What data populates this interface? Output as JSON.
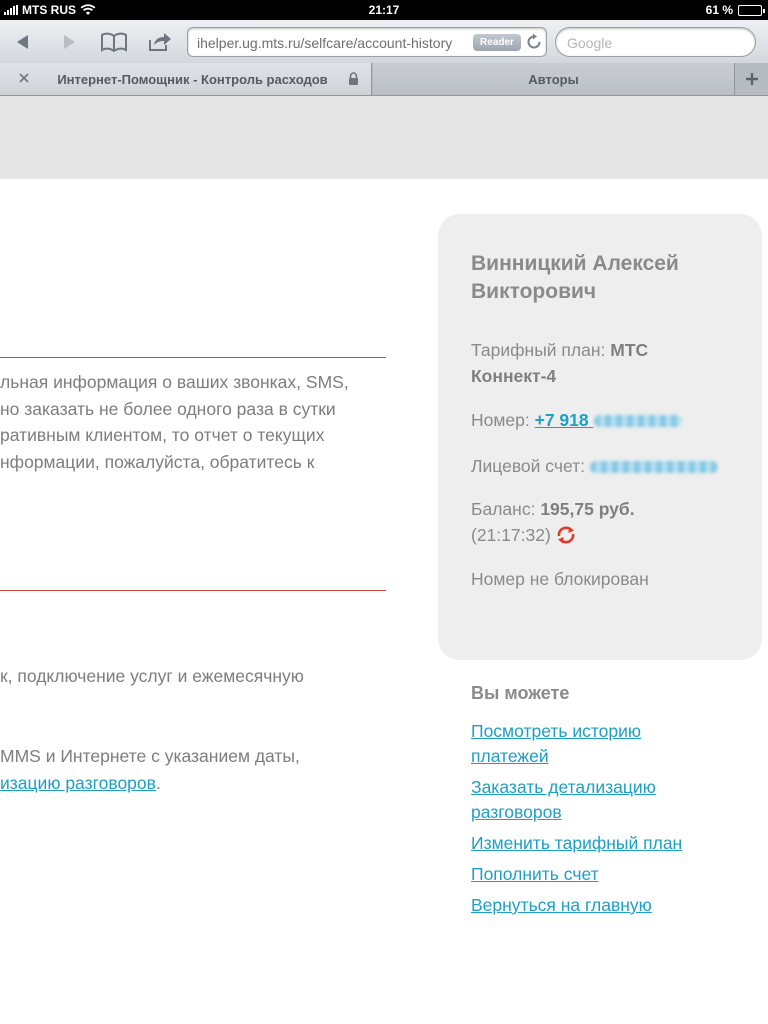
{
  "status_bar": {
    "carrier": "MTS RUS",
    "time": "21:17",
    "battery": "61 %",
    "battery_level": 0.61
  },
  "toolbar": {
    "url": "ihelper.ug.mts.ru/selfcare/account-history",
    "reader_label": "Reader",
    "search_placeholder": "Google"
  },
  "tabs": [
    {
      "title": "Интернет-Помощник - Контроль расходов",
      "active": true,
      "secure": true
    },
    {
      "title": "Авторы",
      "active": false
    }
  ],
  "main": {
    "para1_lines": [
      "льная информация о ваших звонках, SMS,",
      "но заказать не более одного раза в сутки",
      "ративным клиентом, то отчет о текущих",
      "нформации, пожалуйста, обратитесь к"
    ],
    "para2_line": "к, подключение услуг и ежемесячную",
    "para3_line": "MMS и Интернете с указанием даты,",
    "para3_link": "изацию разговоров",
    "para3_tail": "."
  },
  "account": {
    "name_line1": "Винницкий Алексей",
    "name_line2": "Викторович",
    "tariff_label": "Тарифный план:",
    "tariff_value_a": "МТС",
    "tariff_value_b": "Коннект-4",
    "number_label": "Номер:",
    "number_value": "+7 918",
    "account_label": "Лицевой счет:",
    "balance_label": "Баланс:",
    "balance_value": "195,75 руб.",
    "balance_time": "(21:17:32)",
    "status": "Номер не блокирован"
  },
  "actions": {
    "title": "Вы можете",
    "links": [
      {
        "line1": "Посмотреть историю",
        "line2": "платежей"
      },
      {
        "line1": "Заказать детализацию",
        "line2": "разговоров"
      },
      {
        "line1": "Изменить тарифный план"
      },
      {
        "line1": "Пополнить счет"
      },
      {
        "line1": "Вернуться на главную"
      }
    ]
  },
  "colors": {
    "accent_link": "#1d9fc6",
    "divider_red": "#c8483a",
    "card_bg": "#eeeeee"
  }
}
